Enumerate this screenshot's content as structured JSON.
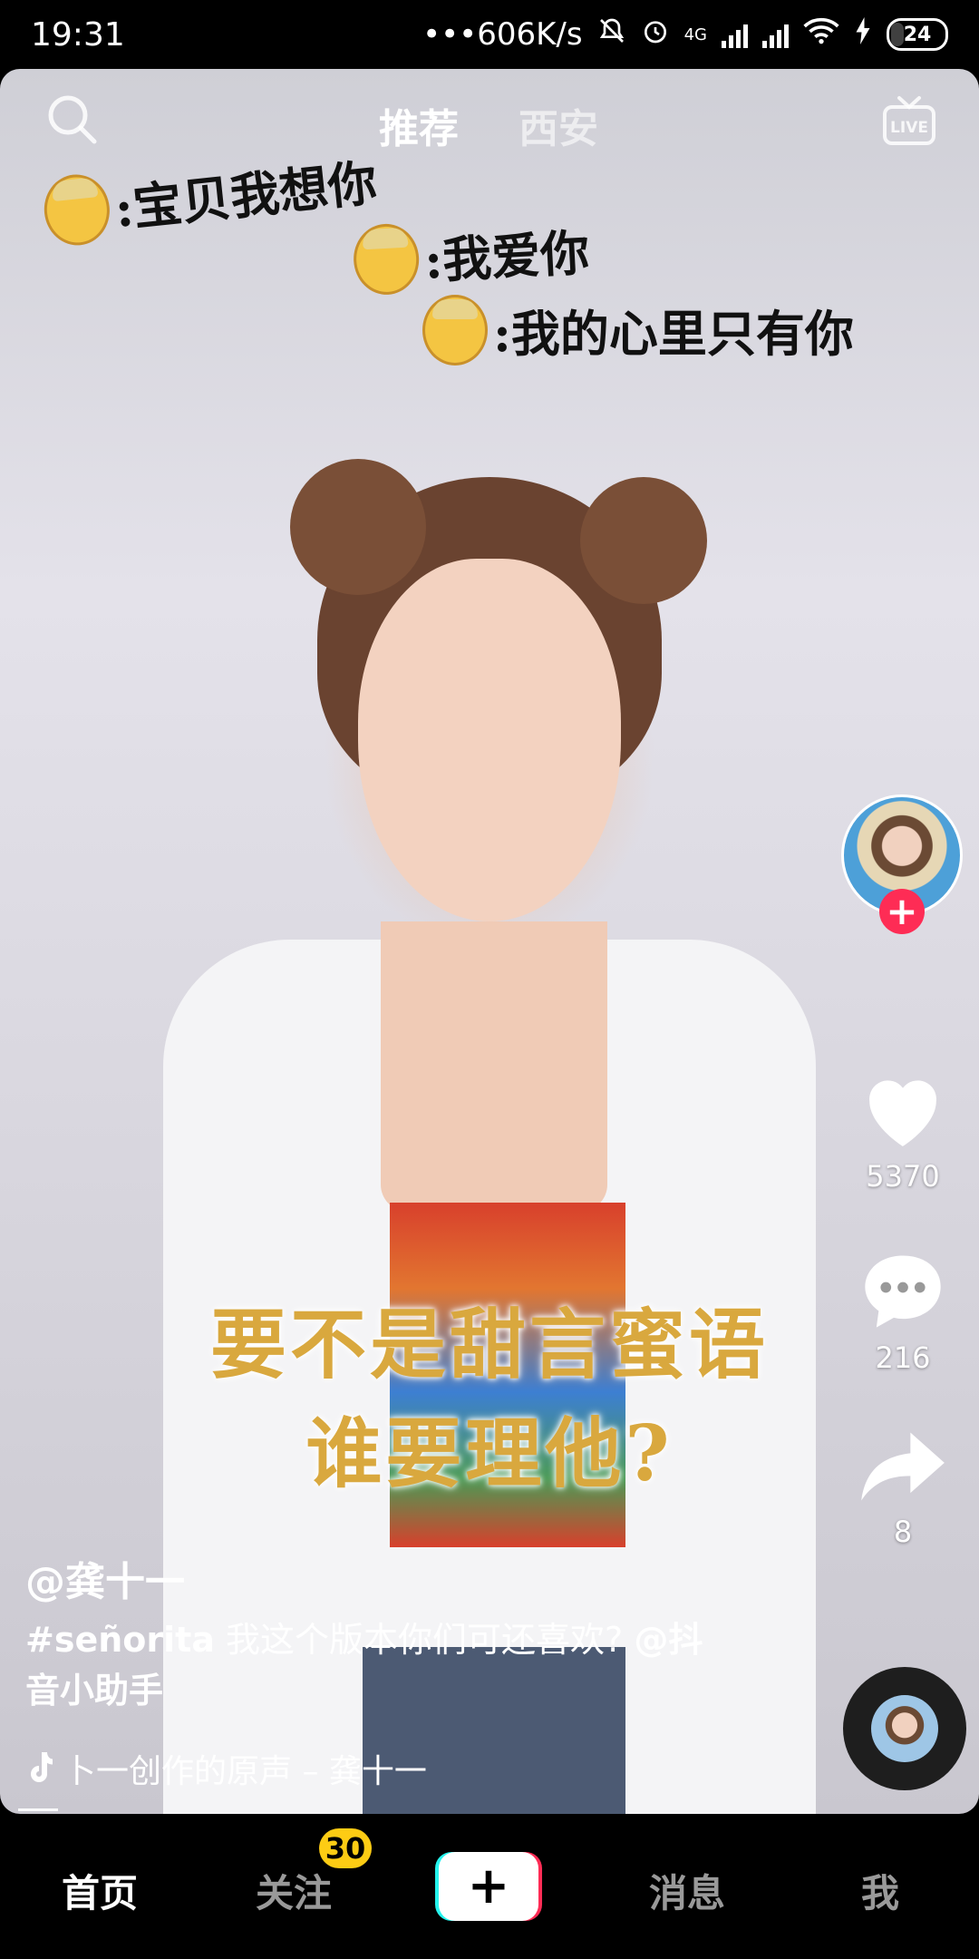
{
  "status_bar": {
    "time": "19:31",
    "network_speed": "•••606K/s",
    "network_type": "4G",
    "battery": "24"
  },
  "top_nav": {
    "tab_recommend": "推荐",
    "tab_city": "西安",
    "search_icon": "search-icon",
    "live_icon": "live-icon"
  },
  "overlay_captions": [
    ":宝贝我想你",
    ":我爱你",
    ":我的心里只有你"
  ],
  "subtitle": {
    "line1": "要不是甜言蜜语",
    "line2": "谁要理他?"
  },
  "side_actions": {
    "follow_icon": "plus-icon",
    "likes": "5370",
    "comments": "216",
    "shares": "8"
  },
  "post": {
    "author": "@龚十一",
    "hashtag": "#señorita",
    "desc_text": " 我这个版本你们可还喜欢? ",
    "mention": "@抖音小助手",
    "music": "卜一创作的原声 – 龚十一"
  },
  "tab_bar": {
    "home": "首页",
    "follow": "关注",
    "follow_badge": "30",
    "create": "+",
    "messages": "消息",
    "me": "我"
  },
  "colors": {
    "accent_red": "#fe2c55",
    "accent_cyan": "#25f4ee",
    "badge_yellow": "#fdcc14",
    "subtitle_gold": "#d9a83e"
  }
}
